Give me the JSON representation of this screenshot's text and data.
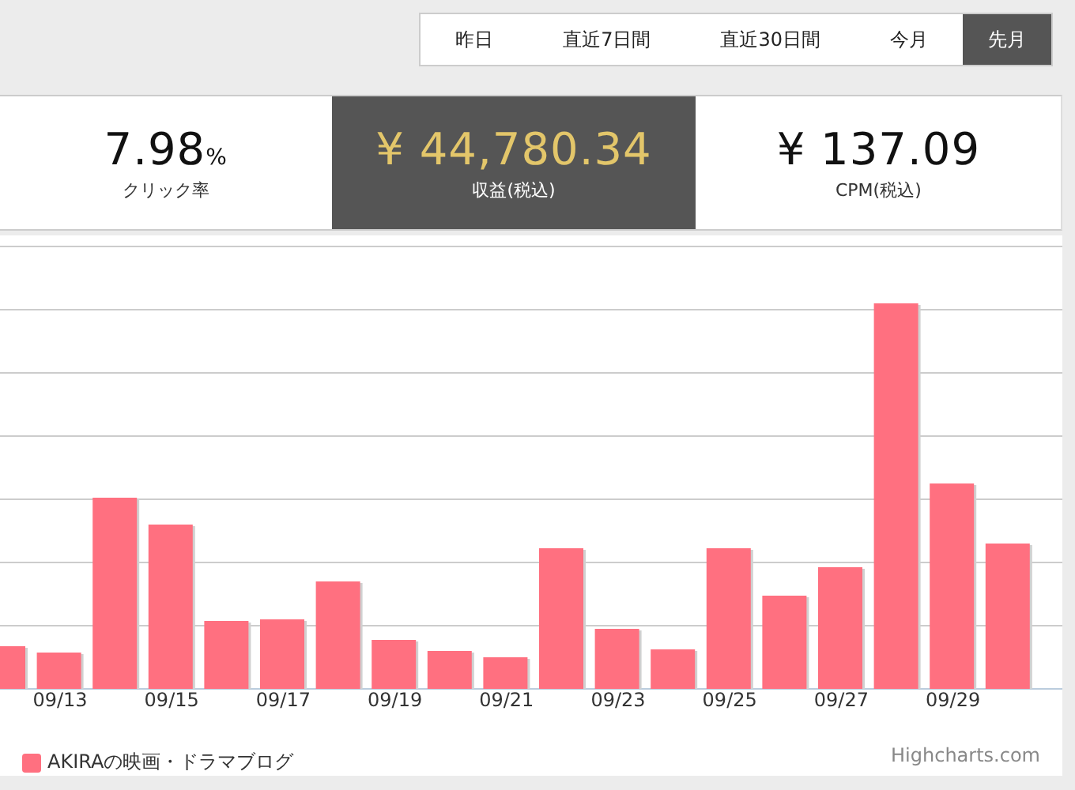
{
  "tabs": [
    {
      "label": "昨日",
      "selected": false
    },
    {
      "label": "直近7日間",
      "selected": false
    },
    {
      "label": "直近30日間",
      "selected": false
    },
    {
      "label": "今月",
      "selected": false
    },
    {
      "label": "先月",
      "selected": true
    }
  ],
  "stats": [
    {
      "value": "7.98",
      "unit": "%",
      "label": "クリック率",
      "selected": false
    },
    {
      "value": "¥ 44,780.34",
      "label": "収益(税込)",
      "selected": true
    },
    {
      "value": "¥ 137.09",
      "label": "CPM(税込)",
      "selected": false
    }
  ],
  "chart": {
    "x_labels": [
      "09/13",
      "09/15",
      "09/17",
      "09/19",
      "09/21",
      "09/23",
      "09/25",
      "09/27",
      "09/29"
    ],
    "legend": {
      "label": "AKIRAの映画・ドラマブログ",
      "color": "#ff7080"
    },
    "credit": "Highcharts.com"
  }
}
